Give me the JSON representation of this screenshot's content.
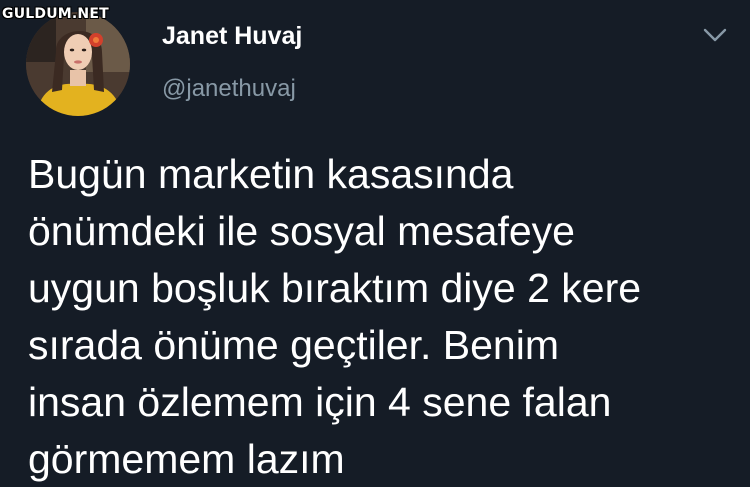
{
  "watermark": {
    "text": "GULDUM.NET"
  },
  "author": {
    "display_name": "Janet Huvaj",
    "handle": "@janethuvaj",
    "avatar_icon": "profile-photo"
  },
  "menu": {
    "icon": "chevron-down-icon"
  },
  "tweet": {
    "lines": [
      "Bugün marketin kasasında",
      "önümdeki ile sosyal mesafeye",
      "uygun boşluk bıraktım diye 2 kere",
      "sırada önüme geçtiler. Benim",
      "insan özlemem için 4 sene falan",
      "görmemem lazım"
    ]
  },
  "colors": {
    "background": "#151c26",
    "text": "#ffffff",
    "secondary_text": "#8899a6"
  }
}
